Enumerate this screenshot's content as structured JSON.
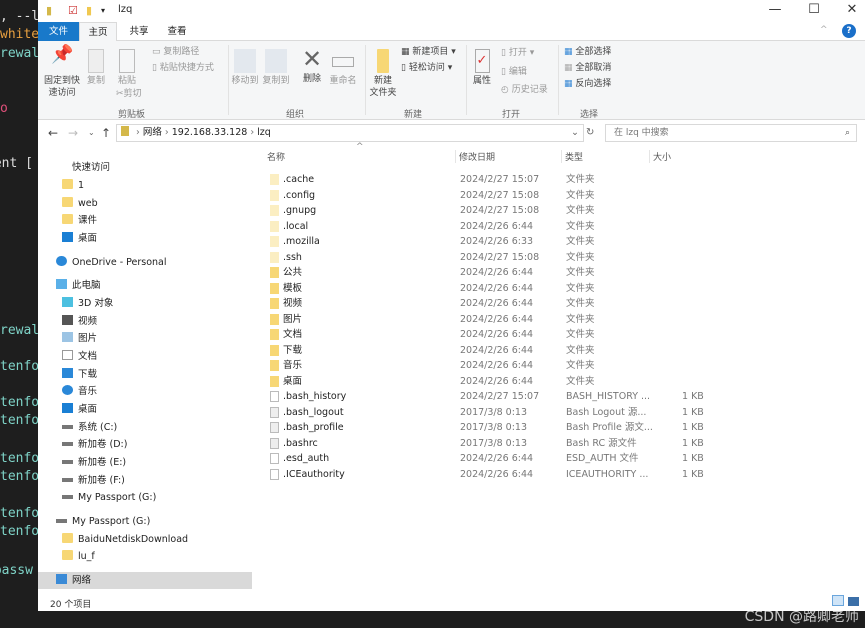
{
  "terminal_fragments": [
    ", --l",
    "white",
    "rewal",
    "o",
    "lent [",
    "rewal",
    "tenfo",
    "tenfo",
    "tenfo",
    "tenfo",
    "tenfo",
    "tenfo",
    "tenfo",
    "opassw"
  ],
  "title": "lzq",
  "window_controls": {
    "minimize": "—",
    "maximize": "☐",
    "close": "✕"
  },
  "tabs": [
    "文件",
    "主页",
    "共享",
    "查看"
  ],
  "ribbon": {
    "clipboard": {
      "pin": "固定到快",
      "pin2": "速访问",
      "copy": "复制",
      "paste": "粘贴",
      "copy_path": "复制路径",
      "paste_shortcut": "粘贴快捷方式",
      "cut": "剪切",
      "group": "剪贴板"
    },
    "organize": {
      "move_to": "移动到",
      "copy_to": "复制到",
      "delete": "删除",
      "rename": "重命名",
      "group": "组织"
    },
    "new": {
      "new_folder": "新建",
      "new_folder2": "文件夹",
      "new_item": "新建项目 ▾",
      "easy_access": "轻松访问 ▾",
      "group": "新建"
    },
    "open": {
      "properties": "属性",
      "open": "打开 ▾",
      "edit": "编辑",
      "history": "历史记录",
      "group": "打开"
    },
    "select": {
      "select_all": "全部选择",
      "select_none": "全部取消",
      "invert": "反向选择",
      "group": "选择"
    }
  },
  "address": {
    "crumbs": [
      "网络",
      "192.168.33.128",
      "lzq"
    ],
    "search_placeholder": "在 lzq 中搜索"
  },
  "nav": [
    {
      "label": "快速访问",
      "icon": "star-icon"
    },
    {
      "label": "1",
      "icon": "folder-icon"
    },
    {
      "label": "web",
      "icon": "folder-icon"
    },
    {
      "label": "课件",
      "icon": "folder-icon"
    },
    {
      "label": "桌面",
      "icon": "desktop-icon"
    },
    {
      "label": "OneDrive - Personal",
      "icon": "cloud-icon"
    },
    {
      "label": "此电脑",
      "icon": "pc-icon"
    },
    {
      "label": "3D 对象",
      "icon": "cube-icon"
    },
    {
      "label": "视频",
      "icon": "video-icon"
    },
    {
      "label": "图片",
      "icon": "picture-icon"
    },
    {
      "label": "文档",
      "icon": "document-icon"
    },
    {
      "label": "下载",
      "icon": "download-icon"
    },
    {
      "label": "音乐",
      "icon": "music-icon"
    },
    {
      "label": "桌面",
      "icon": "desktop-icon"
    },
    {
      "label": "系统 (C:)",
      "icon": "drive-icon"
    },
    {
      "label": "新加卷 (D:)",
      "icon": "drive-icon"
    },
    {
      "label": "新加卷 (E:)",
      "icon": "drive-icon"
    },
    {
      "label": "新加卷 (F:)",
      "icon": "drive-icon"
    },
    {
      "label": "My Passport (G:)",
      "icon": "drive-icon"
    },
    {
      "label": "My Passport (G:)",
      "icon": "drive-icon"
    },
    {
      "label": "BaiduNetdiskDownload",
      "icon": "folder-icon"
    },
    {
      "label": "lu_f",
      "icon": "folder-icon"
    },
    {
      "label": "网络",
      "icon": "network-icon"
    }
  ],
  "columns": [
    "名称",
    "修改日期",
    "类型",
    "大小"
  ],
  "files": [
    {
      "name": ".cache",
      "date": "2024/2/27 15:07",
      "type": "文件夹",
      "size": "",
      "kind": "fl"
    },
    {
      "name": ".config",
      "date": "2024/2/27 15:08",
      "type": "文件夹",
      "size": "",
      "kind": "fl"
    },
    {
      "name": ".gnupg",
      "date": "2024/2/27 15:08",
      "type": "文件夹",
      "size": "",
      "kind": "fl"
    },
    {
      "name": ".local",
      "date": "2024/2/26 6:44",
      "type": "文件夹",
      "size": "",
      "kind": "fl"
    },
    {
      "name": ".mozilla",
      "date": "2024/2/26 6:33",
      "type": "文件夹",
      "size": "",
      "kind": "fl"
    },
    {
      "name": ".ssh",
      "date": "2024/2/27 15:08",
      "type": "文件夹",
      "size": "",
      "kind": "fl"
    },
    {
      "name": "公共",
      "date": "2024/2/26 6:44",
      "type": "文件夹",
      "size": "",
      "kind": "f"
    },
    {
      "name": "模板",
      "date": "2024/2/26 6:44",
      "type": "文件夹",
      "size": "",
      "kind": "f"
    },
    {
      "name": "视频",
      "date": "2024/2/26 6:44",
      "type": "文件夹",
      "size": "",
      "kind": "f"
    },
    {
      "name": "图片",
      "date": "2024/2/26 6:44",
      "type": "文件夹",
      "size": "",
      "kind": "f"
    },
    {
      "name": "文档",
      "date": "2024/2/26 6:44",
      "type": "文件夹",
      "size": "",
      "kind": "f"
    },
    {
      "name": "下载",
      "date": "2024/2/26 6:44",
      "type": "文件夹",
      "size": "",
      "kind": "f"
    },
    {
      "name": "音乐",
      "date": "2024/2/26 6:44",
      "type": "文件夹",
      "size": "",
      "kind": "f"
    },
    {
      "name": "桌面",
      "date": "2024/2/26 6:44",
      "type": "文件夹",
      "size": "",
      "kind": "f"
    },
    {
      "name": ".bash_history",
      "date": "2024/2/27 15:07",
      "type": "BASH_HISTORY ...",
      "size": "1 KB",
      "kind": "d"
    },
    {
      "name": ".bash_logout",
      "date": "2017/3/8 0:13",
      "type": "Bash Logout 源...",
      "size": "1 KB",
      "kind": "g"
    },
    {
      "name": ".bash_profile",
      "date": "2017/3/8 0:13",
      "type": "Bash Profile 源文...",
      "size": "1 KB",
      "kind": "g"
    },
    {
      "name": ".bashrc",
      "date": "2017/3/8 0:13",
      "type": "Bash RC 源文件",
      "size": "1 KB",
      "kind": "g"
    },
    {
      "name": ".esd_auth",
      "date": "2024/2/26 6:44",
      "type": "ESD_AUTH 文件",
      "size": "1 KB",
      "kind": "d"
    },
    {
      "name": ".ICEauthority",
      "date": "2024/2/26 6:44",
      "type": "ICEAUTHORITY ...",
      "size": "1 KB",
      "kind": "d"
    }
  ],
  "status": "20 个项目",
  "watermark": "CSDN @路卿老师"
}
